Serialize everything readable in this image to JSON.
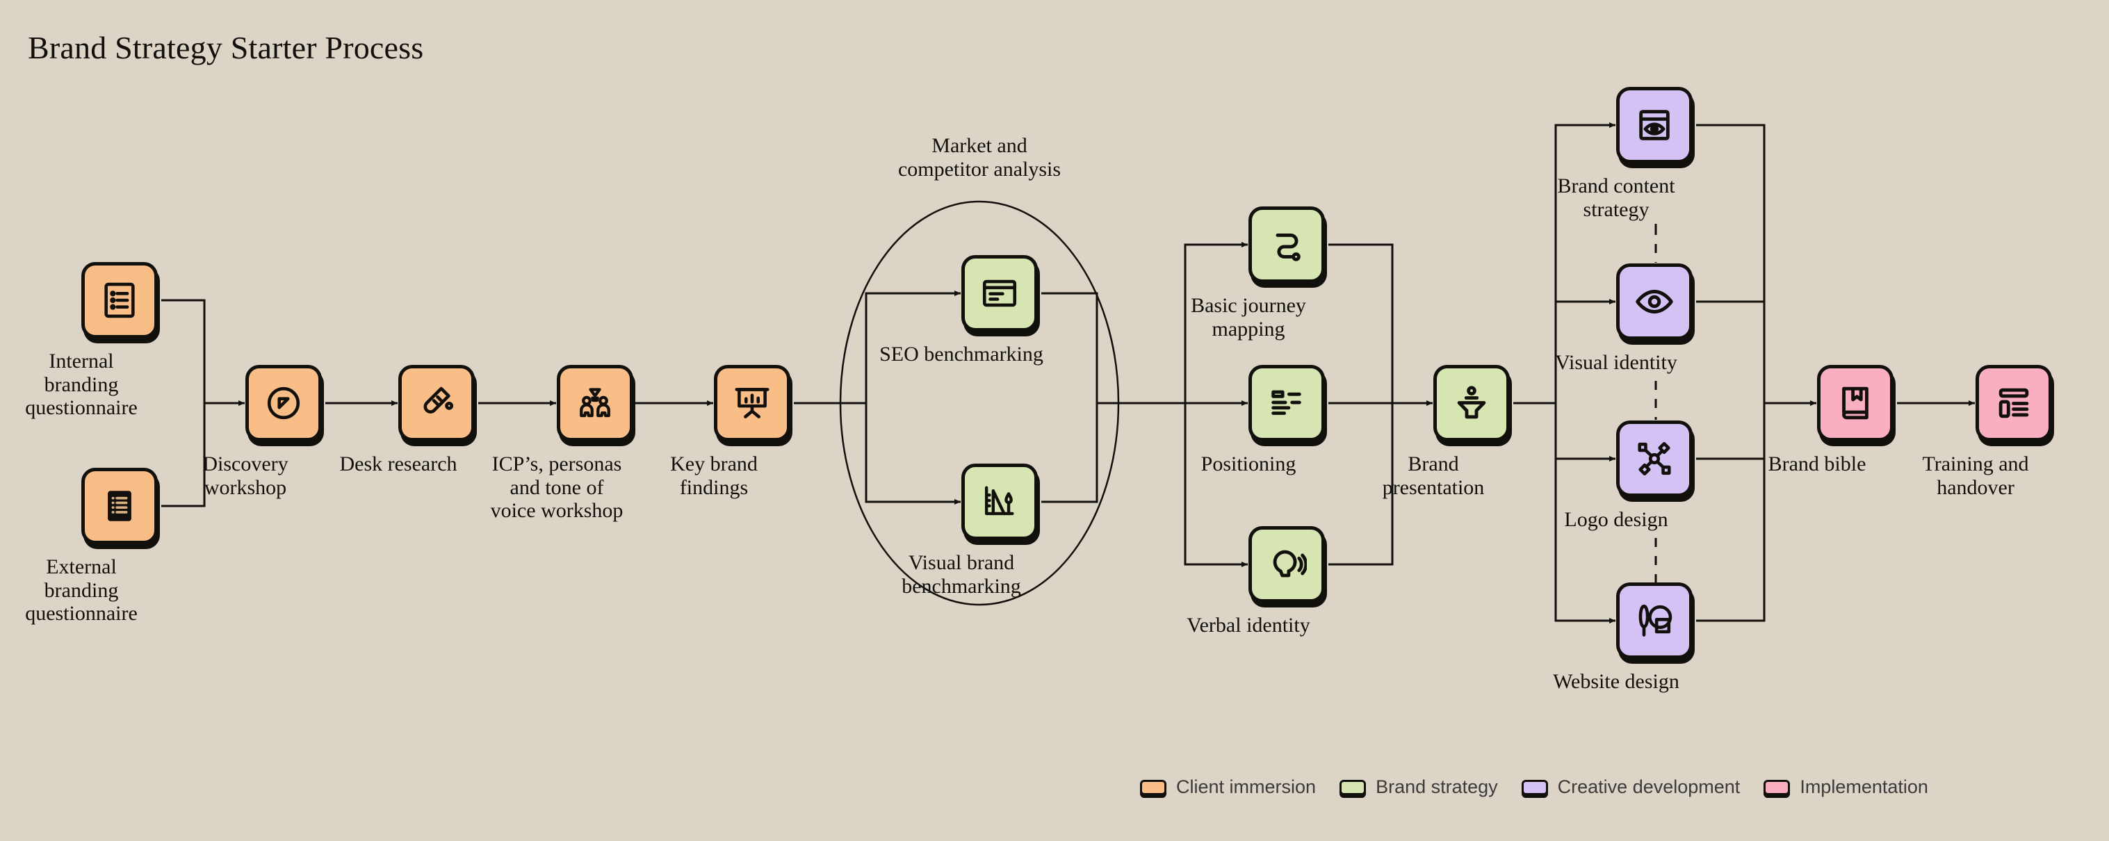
{
  "title": "Brand Strategy Starter Process",
  "colors": {
    "background": "#DCD4C6",
    "ink": "#12100c",
    "client_immersion": "#F9BE88",
    "brand_strategy": "#D6E5B1",
    "creative_development": "#D5C2F5",
    "implementation": "#F9AFC0"
  },
  "groups": [
    {
      "id": "market-analysis",
      "caption": "Market and\ncompetitor analysis"
    }
  ],
  "nodes": [
    {
      "id": "internal-branding-questionnaire",
      "label": "Internal\nbranding\nquestionnaire",
      "icon": "document-list-icon",
      "category": "Client immersion"
    },
    {
      "id": "external-branding-questionnaire",
      "label": "External\nbranding\nquestionnaire",
      "icon": "document-list-filled-icon",
      "category": "Client immersion"
    },
    {
      "id": "discovery-workshop",
      "label": "Discovery\nworkshop",
      "icon": "compass-icon",
      "category": "Client immersion"
    },
    {
      "id": "desk-research",
      "label": "Desk research",
      "icon": "test-tube-icon",
      "category": "Client immersion"
    },
    {
      "id": "icp-personas-tone-of-voice",
      "label": "ICP’s, personas\nand tone of\nvoice workshop",
      "icon": "people-idea-icon",
      "category": "Client immersion"
    },
    {
      "id": "key-brand-findings",
      "label": "Key brand\nfindings",
      "icon": "presentation-chart-icon",
      "category": "Client immersion"
    },
    {
      "id": "seo-benchmarking",
      "label": "SEO benchmarking",
      "icon": "browser-window-icon",
      "category": "Brand strategy"
    },
    {
      "id": "visual-brand-benchmarking",
      "label": "Visual brand\nbenchmarking",
      "icon": "chart-pen-icon",
      "category": "Brand strategy"
    },
    {
      "id": "basic-journey-mapping",
      "label": "Basic journey\nmapping",
      "icon": "route-icon",
      "category": "Brand strategy"
    },
    {
      "id": "positioning",
      "label": "Positioning",
      "icon": "text-layout-icon",
      "category": "Brand strategy"
    },
    {
      "id": "verbal-identity",
      "label": "Verbal identity",
      "icon": "speech-sound-icon",
      "category": "Brand strategy"
    },
    {
      "id": "brand-presentation",
      "label": "Brand\npresentation",
      "icon": "speaker-podium-icon",
      "category": "Brand strategy"
    },
    {
      "id": "brand-content-strategy",
      "label": "Brand content\nstrategy",
      "icon": "window-eye-icon",
      "category": "Creative development"
    },
    {
      "id": "visual-identity",
      "label": "Visual identity",
      "icon": "eye-icon",
      "category": "Creative development"
    },
    {
      "id": "logo-design",
      "label": "Logo design",
      "icon": "shapes-node-icon",
      "category": "Creative development"
    },
    {
      "id": "website-design",
      "label": "Website design",
      "icon": "brush-shape-icon",
      "category": "Creative development"
    },
    {
      "id": "brand-bible",
      "label": "Brand bible",
      "icon": "book-bookmark-icon",
      "category": "Implementation"
    },
    {
      "id": "training-and-handover",
      "label": "Training and\nhandover",
      "icon": "layout-list-icon",
      "category": "Implementation"
    }
  ],
  "legend": [
    {
      "label": "Client immersion",
      "color": "#F9BE88"
    },
    {
      "label": "Brand strategy",
      "color": "#D6E5B1"
    },
    {
      "label": "Creative development",
      "color": "#D5C2F5"
    },
    {
      "label": "Implementation",
      "color": "#F9AFC0"
    }
  ]
}
